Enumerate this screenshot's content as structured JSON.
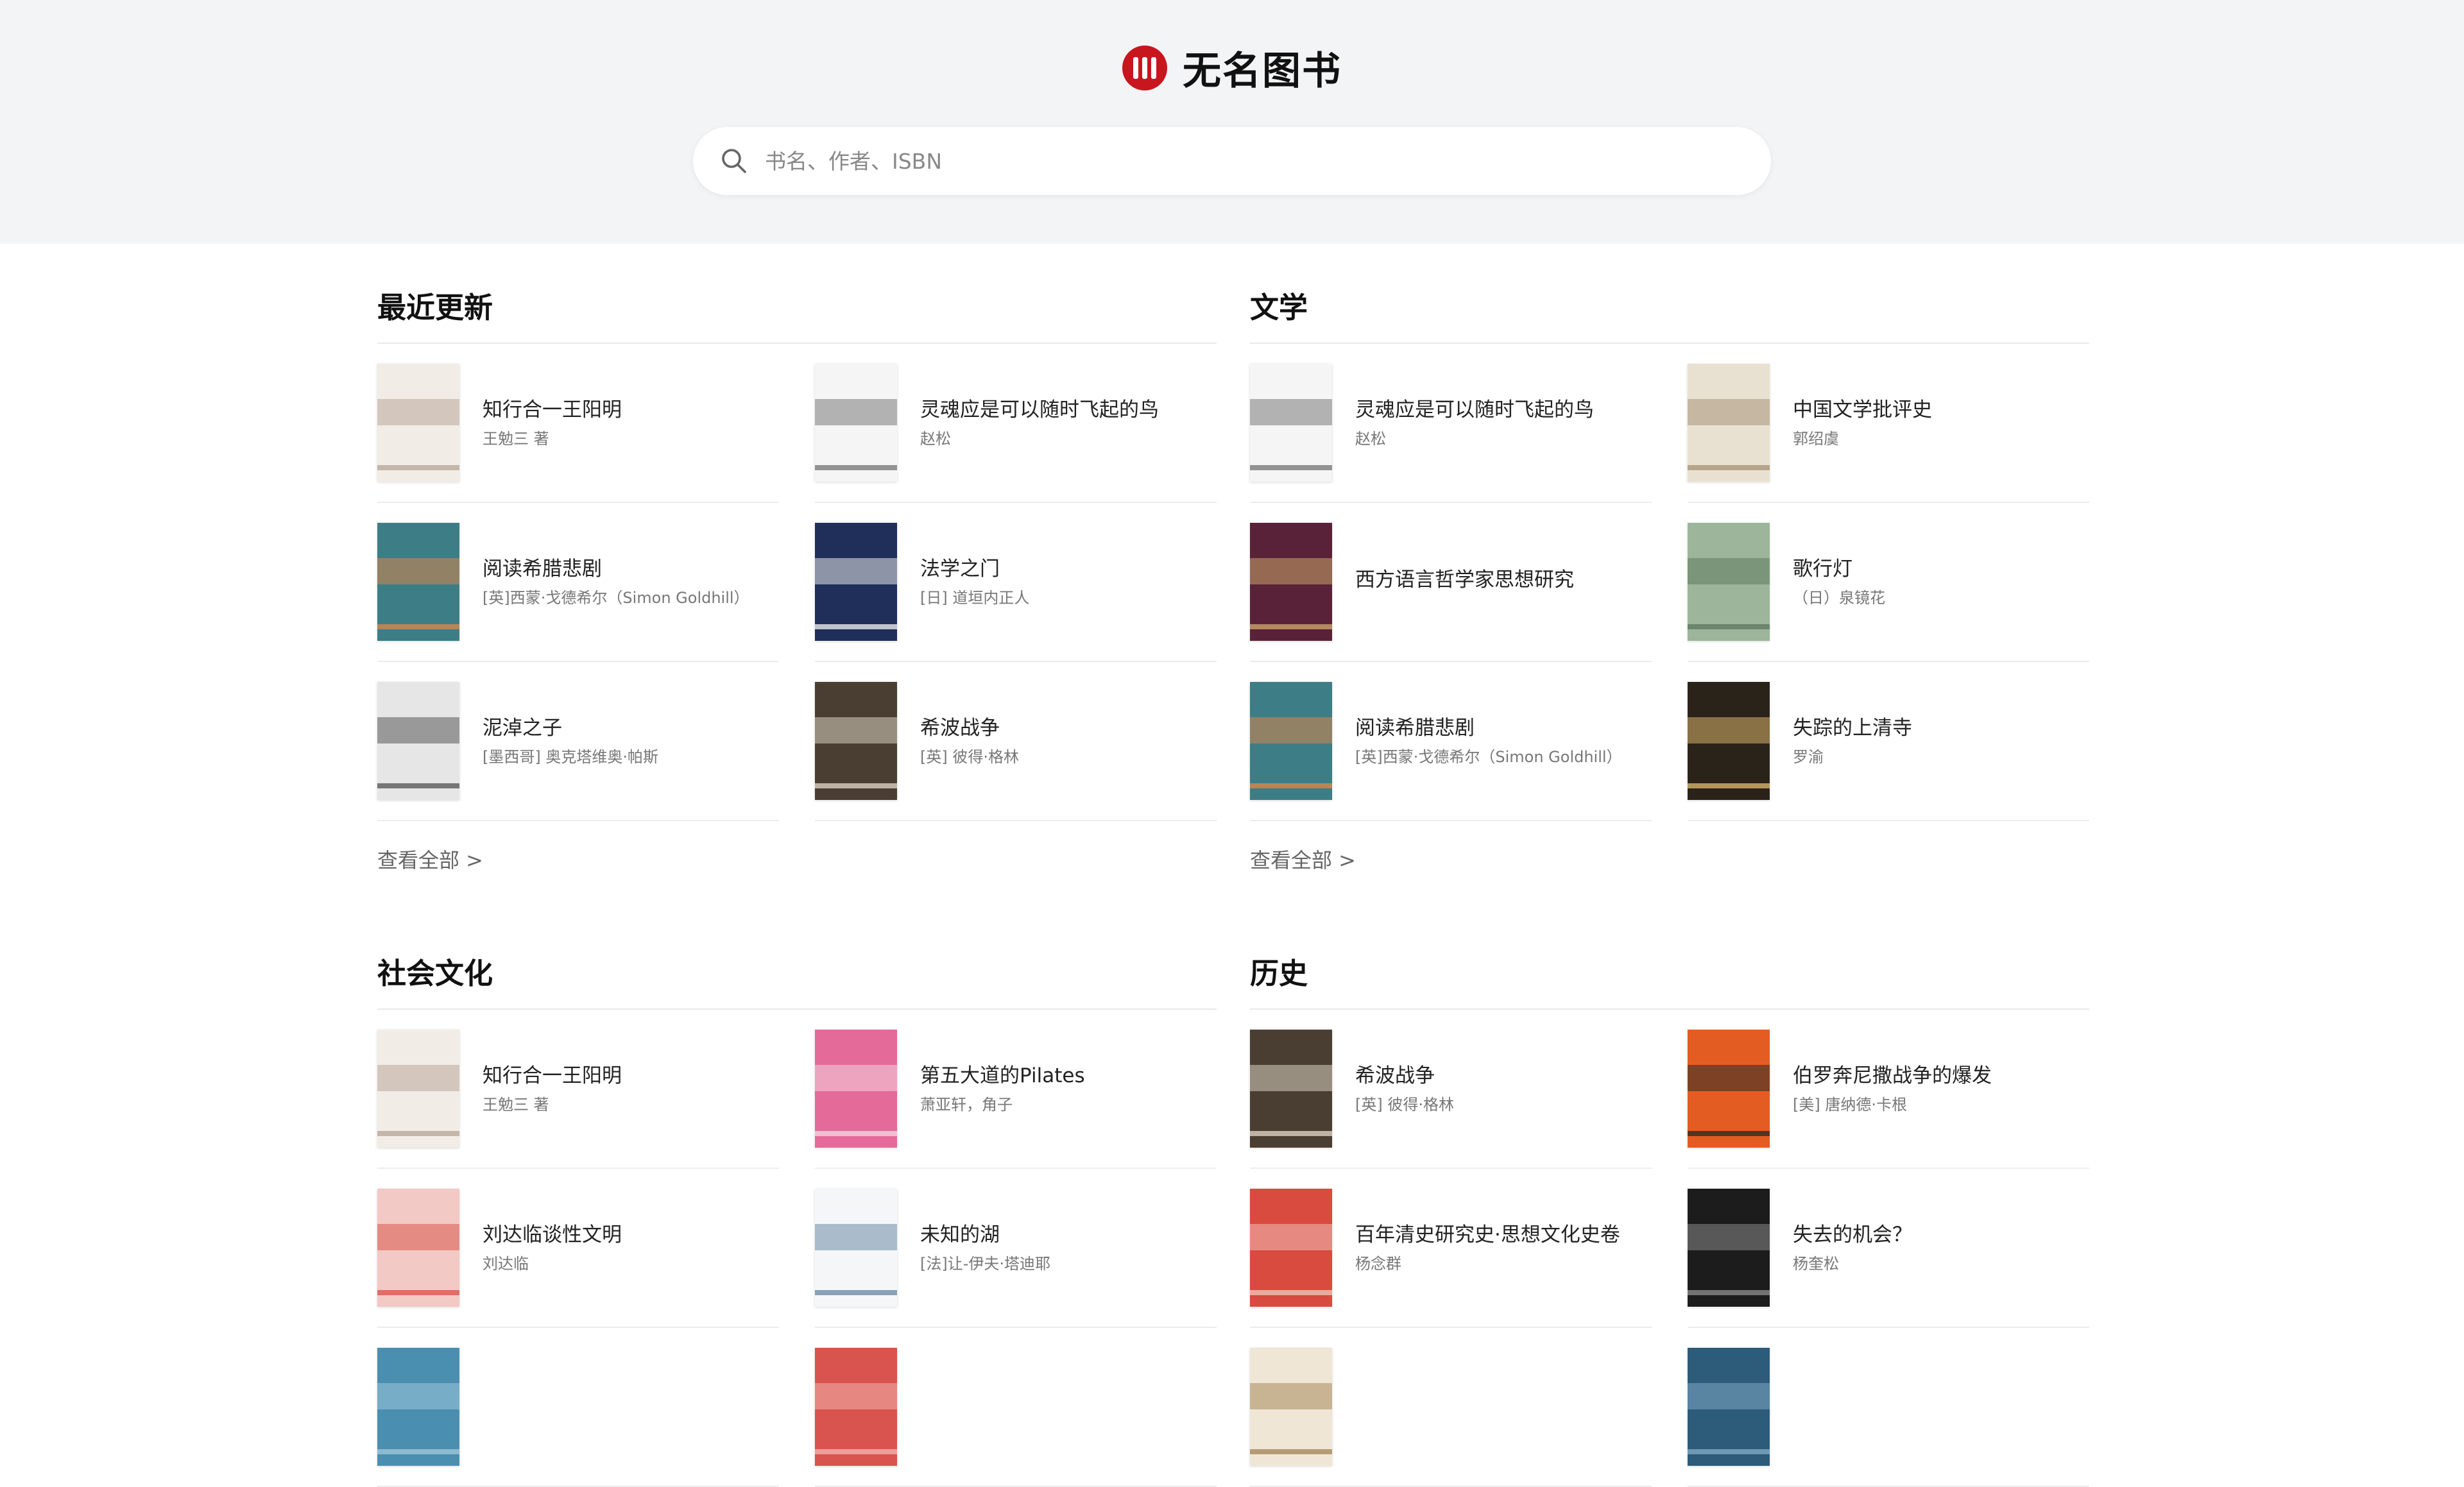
{
  "site": {
    "name": "无名图书"
  },
  "search": {
    "placeholder": "书名、作者、ISBN"
  },
  "view_all_label": "查看全部 >",
  "sections": [
    {
      "title": "最近更新",
      "books": [
        {
          "title": "知行合一王阳明",
          "author": "王勉三 著",
          "cover": {
            "bg": "#f1ece6",
            "accent": "#b9a99a"
          }
        },
        {
          "title": "灵魂应是可以随时飞起的鸟",
          "author": "赵松",
          "cover": {
            "bg": "#f5f5f5",
            "accent": "#7a7a7a"
          }
        },
        {
          "title": "阅读希腊悲剧",
          "author": "[英]西蒙·戈德希尔（Simon Goldhill）",
          "cover": {
            "bg": "#3d7d86",
            "accent": "#d7874a"
          }
        },
        {
          "title": "法学之门",
          "author": "[日] 道垣内正人",
          "cover": {
            "bg": "#1f2f5a",
            "accent": "#e8e8e8"
          }
        },
        {
          "title": "泥淖之子",
          "author": "[墨西哥] 奥克塔维奥·帕斯",
          "cover": {
            "bg": "#e6e6e6",
            "accent": "#5a5a5a"
          }
        },
        {
          "title": "希波战争",
          "author": "[英] 彼得·格林",
          "cover": {
            "bg": "#4a3e32",
            "accent": "#d9cfc0"
          }
        }
      ]
    },
    {
      "title": "文学",
      "books": [
        {
          "title": "灵魂应是可以随时飞起的鸟",
          "author": "赵松",
          "cover": {
            "bg": "#f5f5f5",
            "accent": "#7a7a7a"
          }
        },
        {
          "title": "中国文学批评史",
          "author": "郭绍虞",
          "cover": {
            "bg": "#e8e1d2",
            "accent": "#a89678"
          }
        },
        {
          "title": "西方语言哲学家思想研究",
          "author": "",
          "cover": {
            "bg": "#5a2238",
            "accent": "#c9a46a"
          }
        },
        {
          "title": "歌行灯",
          "author": "（日）泉镜花",
          "cover": {
            "bg": "#9db59a",
            "accent": "#5f7a62"
          }
        },
        {
          "title": "阅读希腊悲剧",
          "author": "[英]西蒙·戈德希尔（Simon Goldhill）",
          "cover": {
            "bg": "#3d7d86",
            "accent": "#d7874a"
          }
        },
        {
          "title": "失踪的上清寺",
          "author": "罗渝",
          "cover": {
            "bg": "#2a231a",
            "accent": "#d7b26a"
          }
        }
      ]
    },
    {
      "title": "社会文化",
      "books": [
        {
          "title": "知行合一王阳明",
          "author": "王勉三 著",
          "cover": {
            "bg": "#f1ece6",
            "accent": "#b9a99a"
          }
        },
        {
          "title": "第五大道的Pilates",
          "author": "萧亚轩，角子",
          "cover": {
            "bg": "#e46a9a",
            "accent": "#f2d4df"
          }
        },
        {
          "title": "刘达临谈性文明",
          "author": "刘达临",
          "cover": {
            "bg": "#f2c9c5",
            "accent": "#d9574f"
          }
        },
        {
          "title": "未知的湖",
          "author": "[法]让-伊夫·塔迪耶",
          "cover": {
            "bg": "#f4f6f8",
            "accent": "#6e8ba6"
          }
        },
        {
          "title": "",
          "author": "",
          "cover": {
            "bg": "#4a8fb0",
            "accent": "#9cc6d8"
          }
        },
        {
          "title": "",
          "author": "",
          "cover": {
            "bg": "#d9534f",
            "accent": "#f0b2ad"
          }
        }
      ]
    },
    {
      "title": "历史",
      "books": [
        {
          "title": "希波战争",
          "author": "[英] 彼得·格林",
          "cover": {
            "bg": "#4a3e32",
            "accent": "#d9cfc0"
          }
        },
        {
          "title": "伯罗奔尼撒战争的爆发",
          "author": "[美] 唐纳德·卡根",
          "cover": {
            "bg": "#e35d22",
            "accent": "#2a2a2a"
          }
        },
        {
          "title": "百年清史研究史·思想文化史卷",
          "author": "杨念群",
          "cover": {
            "bg": "#d94a3f",
            "accent": "#f0c0b8"
          }
        },
        {
          "title": "失去的机会？",
          "author": "杨奎松",
          "cover": {
            "bg": "#1c1c1c",
            "accent": "#8a8a8a"
          }
        },
        {
          "title": "",
          "author": "",
          "cover": {
            "bg": "#efe6d6",
            "accent": "#a88a5c"
          }
        },
        {
          "title": "",
          "author": "",
          "cover": {
            "bg": "#2d5b7a",
            "accent": "#7fa8c2"
          }
        }
      ]
    }
  ]
}
